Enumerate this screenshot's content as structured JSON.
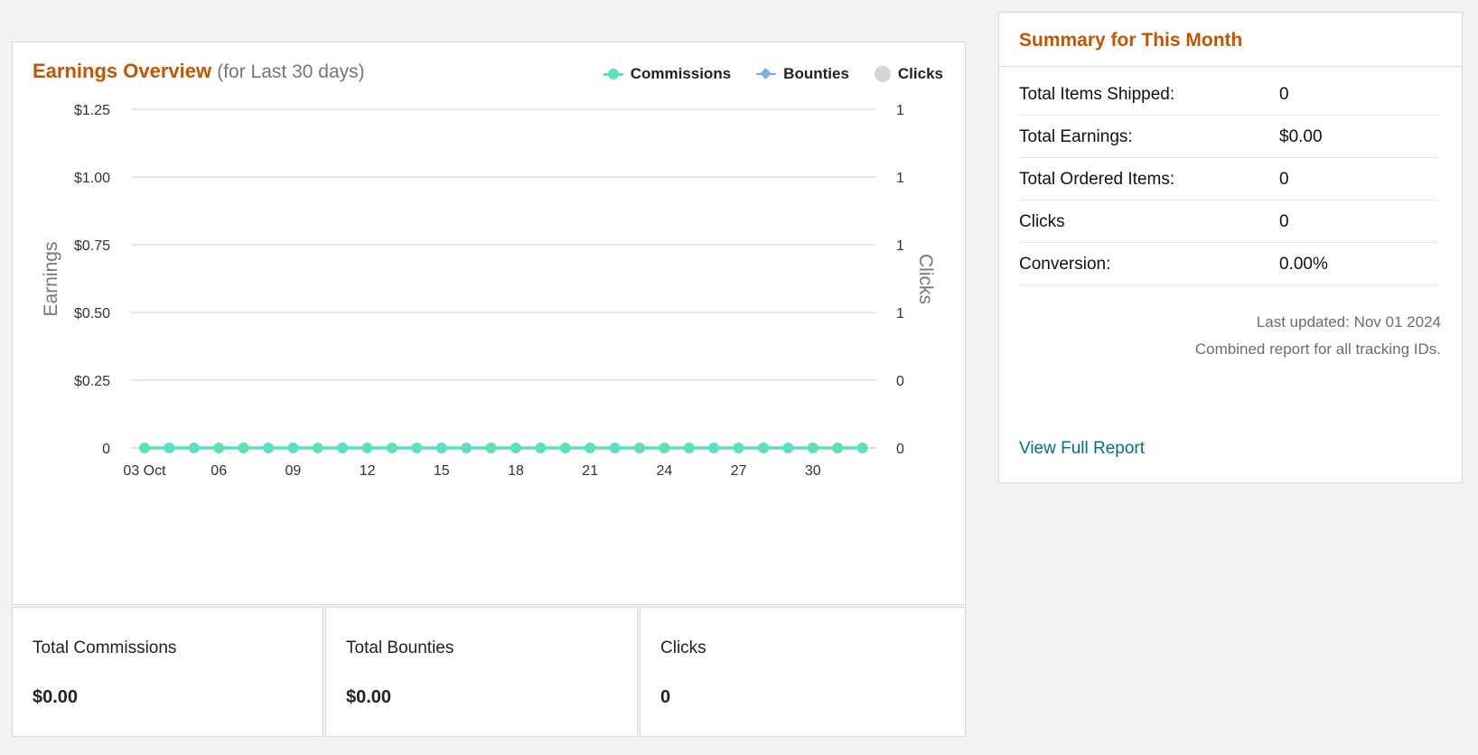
{
  "chart_panel": {
    "title": "Earnings Overview",
    "subtitle": "(for Last 30 days)",
    "legend": [
      {
        "label": "Commissions",
        "color": "#5ee0bd",
        "marker": "circle"
      },
      {
        "label": "Bounties",
        "color": "#7ab0e6",
        "marker": "diamond"
      },
      {
        "label": "Clicks",
        "color": "#d6d6d6",
        "marker": "circle"
      }
    ]
  },
  "chart_data": {
    "type": "line",
    "ylabel": "Earnings",
    "y2label": "Clicks",
    "ylim": [
      0,
      1.25
    ],
    "y_ticks": [
      "0",
      "$0.25",
      "$0.50",
      "$0.75",
      "$1.00",
      "$1.25"
    ],
    "y2_ticks": [
      "0",
      "0",
      "1",
      "1",
      "1",
      "1"
    ],
    "x_tick_labels": [
      "03 Oct",
      "06",
      "09",
      "12",
      "15",
      "18",
      "21",
      "24",
      "27",
      "30"
    ],
    "x": [
      "Oct 03",
      "Oct 04",
      "Oct 05",
      "Oct 06",
      "Oct 07",
      "Oct 08",
      "Oct 09",
      "Oct 10",
      "Oct 11",
      "Oct 12",
      "Oct 13",
      "Oct 14",
      "Oct 15",
      "Oct 16",
      "Oct 17",
      "Oct 18",
      "Oct 19",
      "Oct 20",
      "Oct 21",
      "Oct 22",
      "Oct 23",
      "Oct 24",
      "Oct 25",
      "Oct 26",
      "Oct 27",
      "Oct 28",
      "Oct 29",
      "Oct 30",
      "Oct 31",
      "Nov 01"
    ],
    "series": [
      {
        "name": "Commissions",
        "color": "#5ee0bd",
        "values": [
          0,
          0,
          0,
          0,
          0,
          0,
          0,
          0,
          0,
          0,
          0,
          0,
          0,
          0,
          0,
          0,
          0,
          0,
          0,
          0,
          0,
          0,
          0,
          0,
          0,
          0,
          0,
          0,
          0,
          0
        ]
      },
      {
        "name": "Bounties",
        "color": "#7ab0e6",
        "values": [
          0,
          0,
          0,
          0,
          0,
          0,
          0,
          0,
          0,
          0,
          0,
          0,
          0,
          0,
          0,
          0,
          0,
          0,
          0,
          0,
          0,
          0,
          0,
          0,
          0,
          0,
          0,
          0,
          0,
          0
        ]
      },
      {
        "name": "Clicks",
        "color": "#d6d6d6",
        "values": [
          0,
          0,
          0,
          0,
          0,
          0,
          0,
          0,
          0,
          0,
          0,
          0,
          0,
          0,
          0,
          0,
          0,
          0,
          0,
          0,
          0,
          0,
          0,
          0,
          0,
          0,
          0,
          0,
          0,
          0
        ]
      }
    ],
    "grid": true,
    "legend_position": "top-right"
  },
  "stats": [
    {
      "label": "Total Commissions",
      "value": "$0.00"
    },
    {
      "label": "Total Bounties",
      "value": "$0.00"
    },
    {
      "label": "Clicks",
      "value": "0"
    }
  ],
  "summary": {
    "title": "Summary for This Month",
    "rows": [
      {
        "label": "Total Items Shipped:",
        "value": "0"
      },
      {
        "label": "Total Earnings:",
        "value": "$0.00"
      },
      {
        "label": "Total Ordered Items:",
        "value": "0"
      },
      {
        "label": "Clicks",
        "value": "0"
      },
      {
        "label": "Conversion:",
        "value": "0.00%"
      }
    ],
    "last_updated": "Last updated: Nov 01 2024",
    "combined_note": "Combined report for all tracking IDs.",
    "link_label": "View Full Report"
  }
}
